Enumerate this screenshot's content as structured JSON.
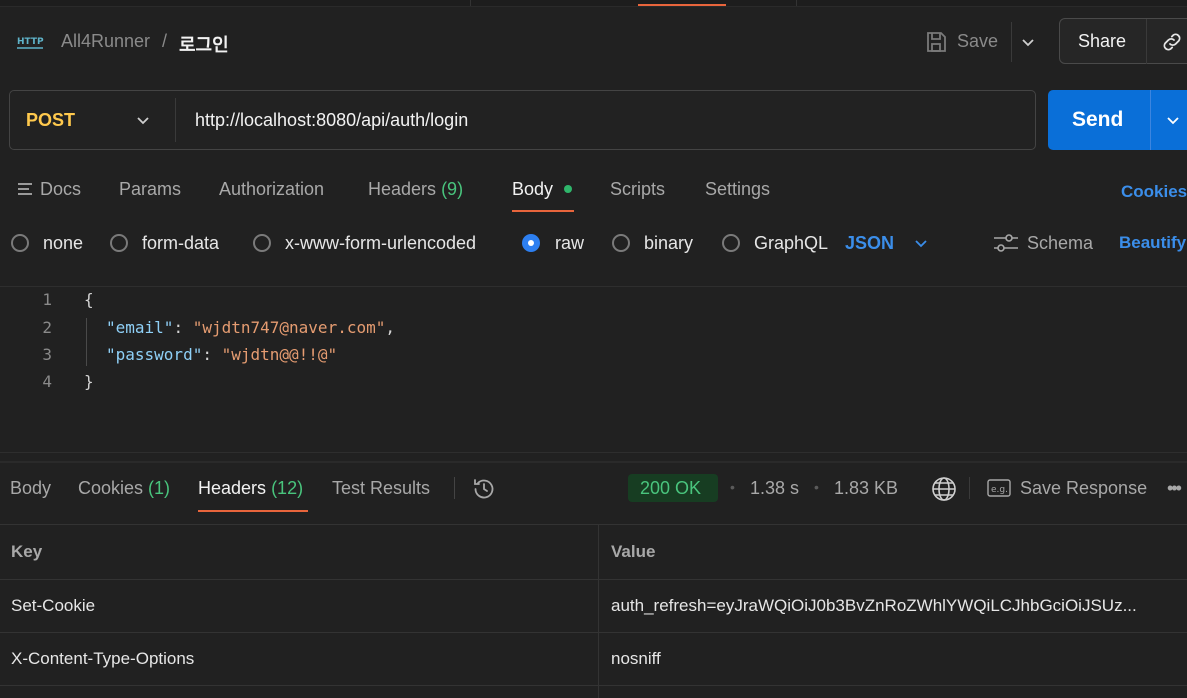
{
  "header": {
    "collection": "All4Runner",
    "separator": "/",
    "request_name": "로그인",
    "save_label": "Save",
    "share_label": "Share",
    "http_icon_text": "HTTP"
  },
  "request": {
    "method": "POST",
    "url": "http://localhost:8080/api/auth/login",
    "send_label": "Send"
  },
  "request_tabs": {
    "docs": "Docs",
    "params": "Params",
    "authorization": "Authorization",
    "headers": "Headers",
    "headers_count": "(9)",
    "body": "Body",
    "scripts": "Scripts",
    "settings": "Settings",
    "cookies": "Cookies",
    "active": "Body"
  },
  "body_types": {
    "none": "none",
    "form_data": "form-data",
    "urlencoded": "x-www-form-urlencoded",
    "raw": "raw",
    "binary": "binary",
    "graphql": "GraphQL",
    "selected": "raw",
    "format": "JSON",
    "schema": "Schema",
    "beautify": "Beautify"
  },
  "editor": {
    "line_numbers": [
      "1",
      "2",
      "3",
      "4"
    ],
    "line1": "{",
    "email_key": "\"email\"",
    "email_value": "\"wjdtn747@naver.com\"",
    "password_key": "\"password\"",
    "password_value": "\"wjdtn@@!!@\"",
    "line4": "}"
  },
  "response": {
    "tabs": {
      "body": "Body",
      "cookies": "Cookies",
      "cookies_count": "(1)",
      "headers": "Headers",
      "headers_count": "(12)",
      "test_results": "Test Results",
      "active": "Headers"
    },
    "status": "200 OK",
    "time": "1.38 s",
    "size": "1.83 KB",
    "bullet": "•",
    "save_response": "Save Response"
  },
  "headers_table": {
    "columns": [
      "Key",
      "Value"
    ],
    "rows": [
      {
        "key": "Set-Cookie",
        "value": "auth_refresh=eyJraWQiOiJ0b3BvZnRoZWhlYWQiLCJhbGciOiJSUz..."
      },
      {
        "key": "X-Content-Type-Options",
        "value": "nosniff"
      }
    ]
  },
  "colors": {
    "accent_orange": "#e8653c",
    "send_blue": "#0a6fd8",
    "method_yellow": "#ffc94d",
    "status_green": "#49c47d",
    "link_blue": "#3b8eea"
  }
}
